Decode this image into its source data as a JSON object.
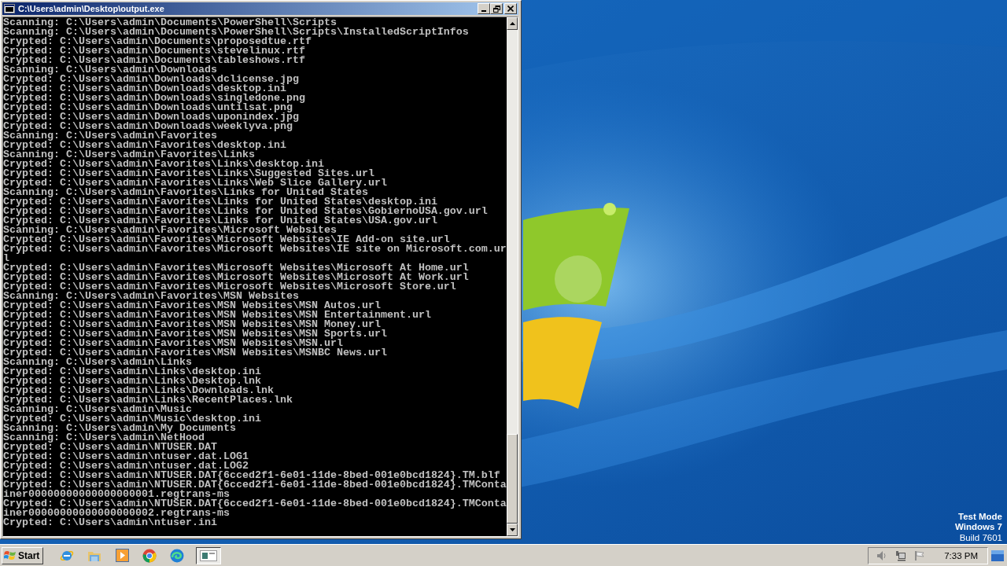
{
  "window": {
    "title": "C:\\Users\\admin\\Desktop\\output.exe"
  },
  "console": {
    "lines": [
      "Scanning: C:\\Users\\admin\\Documents\\PowerShell\\Scripts",
      "Scanning: C:\\Users\\admin\\Documents\\PowerShell\\Scripts\\InstalledScriptInfos",
      "Crypted: C:\\Users\\admin\\Documents\\proposedtue.rtf",
      "Crypted: C:\\Users\\admin\\Documents\\stevelinux.rtf",
      "Crypted: C:\\Users\\admin\\Documents\\tableshows.rtf",
      "Scanning: C:\\Users\\admin\\Downloads",
      "Crypted: C:\\Users\\admin\\Downloads\\dclicense.jpg",
      "Crypted: C:\\Users\\admin\\Downloads\\desktop.ini",
      "Crypted: C:\\Users\\admin\\Downloads\\singledone.png",
      "Crypted: C:\\Users\\admin\\Downloads\\untilsat.png",
      "Crypted: C:\\Users\\admin\\Downloads\\uponindex.jpg",
      "Crypted: C:\\Users\\admin\\Downloads\\weeklyva.png",
      "Scanning: C:\\Users\\admin\\Favorites",
      "Crypted: C:\\Users\\admin\\Favorites\\desktop.ini",
      "Scanning: C:\\Users\\admin\\Favorites\\Links",
      "Crypted: C:\\Users\\admin\\Favorites\\Links\\desktop.ini",
      "Crypted: C:\\Users\\admin\\Favorites\\Links\\Suggested Sites.url",
      "Crypted: C:\\Users\\admin\\Favorites\\Links\\Web Slice Gallery.url",
      "Scanning: C:\\Users\\admin\\Favorites\\Links for United States",
      "Crypted: C:\\Users\\admin\\Favorites\\Links for United States\\desktop.ini",
      "Crypted: C:\\Users\\admin\\Favorites\\Links for United States\\GobiernoUSA.gov.url",
      "Crypted: C:\\Users\\admin\\Favorites\\Links for United States\\USA.gov.url",
      "Scanning: C:\\Users\\admin\\Favorites\\Microsoft Websites",
      "Crypted: C:\\Users\\admin\\Favorites\\Microsoft Websites\\IE Add-on site.url",
      "Crypted: C:\\Users\\admin\\Favorites\\Microsoft Websites\\IE site on Microsoft.com.ur",
      "l",
      "Crypted: C:\\Users\\admin\\Favorites\\Microsoft Websites\\Microsoft At Home.url",
      "Crypted: C:\\Users\\admin\\Favorites\\Microsoft Websites\\Microsoft At Work.url",
      "Crypted: C:\\Users\\admin\\Favorites\\Microsoft Websites\\Microsoft Store.url",
      "Scanning: C:\\Users\\admin\\Favorites\\MSN Websites",
      "Crypted: C:\\Users\\admin\\Favorites\\MSN Websites\\MSN Autos.url",
      "Crypted: C:\\Users\\admin\\Favorites\\MSN Websites\\MSN Entertainment.url",
      "Crypted: C:\\Users\\admin\\Favorites\\MSN Websites\\MSN Money.url",
      "Crypted: C:\\Users\\admin\\Favorites\\MSN Websites\\MSN Sports.url",
      "Crypted: C:\\Users\\admin\\Favorites\\MSN Websites\\MSN.url",
      "Crypted: C:\\Users\\admin\\Favorites\\MSN Websites\\MSNBC News.url",
      "Scanning: C:\\Users\\admin\\Links",
      "Crypted: C:\\Users\\admin\\Links\\desktop.ini",
      "Crypted: C:\\Users\\admin\\Links\\Desktop.lnk",
      "Crypted: C:\\Users\\admin\\Links\\Downloads.lnk",
      "Crypted: C:\\Users\\admin\\Links\\RecentPlaces.lnk",
      "Scanning: C:\\Users\\admin\\Music",
      "Crypted: C:\\Users\\admin\\Music\\desktop.ini",
      "Scanning: C:\\Users\\admin\\My Documents",
      "Scanning: C:\\Users\\admin\\NetHood",
      "Crypted: C:\\Users\\admin\\NTUSER.DAT",
      "Crypted: C:\\Users\\admin\\ntuser.dat.LOG1",
      "Crypted: C:\\Users\\admin\\ntuser.dat.LOG2",
      "Crypted: C:\\Users\\admin\\NTUSER.DAT{6cced2f1-6e01-11de-8bed-001e0bcd1824}.TM.blf",
      "Crypted: C:\\Users\\admin\\NTUSER.DAT{6cced2f1-6e01-11de-8bed-001e0bcd1824}.TMConta",
      "iner00000000000000000001.regtrans-ms",
      "Crypted: C:\\Users\\admin\\NTUSER.DAT{6cced2f1-6e01-11de-8bed-001e0bcd1824}.TMConta",
      "iner00000000000000000002.regtrans-ms",
      "Crypted: C:\\Users\\admin\\ntuser.ini"
    ]
  },
  "desktop": {
    "notice": [
      "Test Mode",
      "Windows 7",
      "Build 7601"
    ]
  },
  "taskbar": {
    "start": "Start",
    "pinned": [
      {
        "kind": "ie"
      },
      {
        "kind": "explorer"
      },
      {
        "kind": "media"
      },
      {
        "kind": "chrome"
      },
      {
        "kind": "edge"
      }
    ],
    "tasks": [
      {
        "kind": "console",
        "selected": true
      }
    ],
    "clock": "7:33 PM"
  }
}
